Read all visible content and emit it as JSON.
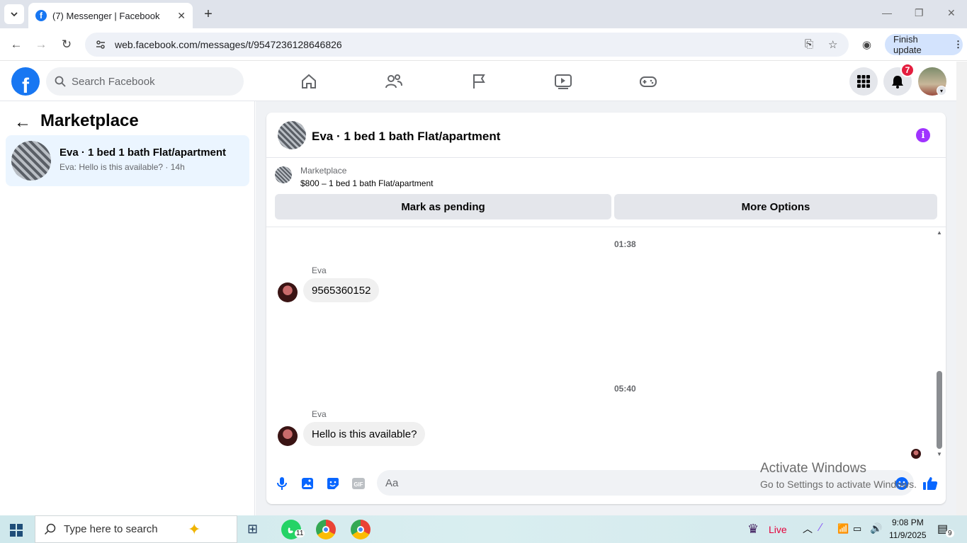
{
  "browser": {
    "tab_title": "(7) Messenger | Facebook",
    "url": "web.facebook.com/messages/t/9547236128646826",
    "finish_update_label": "Finish update"
  },
  "fb_header": {
    "search_placeholder": "Search Facebook",
    "notification_count": "7"
  },
  "left_panel": {
    "title": "Marketplace",
    "conversations": [
      {
        "name": "Eva · 1 bed 1 bath Flat/apartment",
        "snippet": "Eva: Hello is this available? · 14h"
      }
    ]
  },
  "chat": {
    "title": "Eva · 1 bed 1 bath Flat/apartment",
    "marketplace_label": "Marketplace",
    "listing": "$800 – 1 bed 1 bath Flat/apartment",
    "mark_pending_label": "Mark as pending",
    "more_options_label": "More Options",
    "messages": [
      {
        "time": "01:38",
        "sender": "Eva",
        "text": "9565360152"
      },
      {
        "time": "05:40",
        "sender": "Eva",
        "text": "Hello is this available?"
      }
    ],
    "composer_placeholder": "Aa"
  },
  "watermark": {
    "line1": "Activate Windows",
    "line2": "Go to Settings to activate Windows."
  },
  "taskbar": {
    "search_placeholder": "Type here to search",
    "whatsapp_badge": "11",
    "live_label": "Live",
    "time": "9:08 PM",
    "date": "11/9/2025",
    "notification_count": "9"
  },
  "colors": {
    "facebook_blue": "#1877f2",
    "selected_convo_bg": "#ebf5ff",
    "info_purple": "#a033ff",
    "badge_red": "#e41e3f"
  }
}
